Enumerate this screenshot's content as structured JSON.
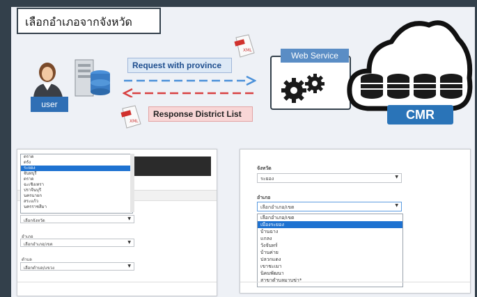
{
  "slide": {
    "title": "เลือกอำเภอจากจังหวัด",
    "request_label": "Request with province",
    "response_label": "Response District List",
    "user_label": "user",
    "webservice_label": "Web Service",
    "cmr_label": "CMR",
    "xml_label": "XML"
  },
  "left_panel": {
    "list_items": [
      "ตราด",
      "ตรัง",
      "ระยอง",
      "จันทบุรี",
      "ตราด",
      "ฉะเชิงเทรา",
      "ปราจีนบุรี",
      "นครนายก",
      "สระแก้ว",
      "นครราชสีมา"
    ],
    "selected_index": 2,
    "province_select": "เลือกจังหวัด",
    "district_label": "อำเภอ",
    "district_select": "เลือกอำเภอ/เขต",
    "subdistrict_label": "ตำบล",
    "subdistrict_select": "เลือกตำบล/แขวง"
  },
  "right_panel": {
    "province_label": "จังหวัด",
    "province_value": "ระยอง",
    "district_label": "อำเภอ",
    "district_select": "เลือกอำเภอ/เขต",
    "district_items": [
      "เลือกอำเภอ/เขต",
      "เมืองระยอง",
      "บ้านฉาง",
      "แกลง",
      "วังจันทร์",
      "บ้านค่าย",
      "ปลวกแดง",
      "เขาชะเมา",
      "นิคมพัฒนา",
      "สาขาตำบลมาบข่า*"
    ],
    "selected_index": 1
  },
  "colors": {
    "frame": "#33404b",
    "slide_bg": "#eef1f6",
    "highlight": "#1e72d1",
    "cmr_blue": "#2a74b8"
  }
}
